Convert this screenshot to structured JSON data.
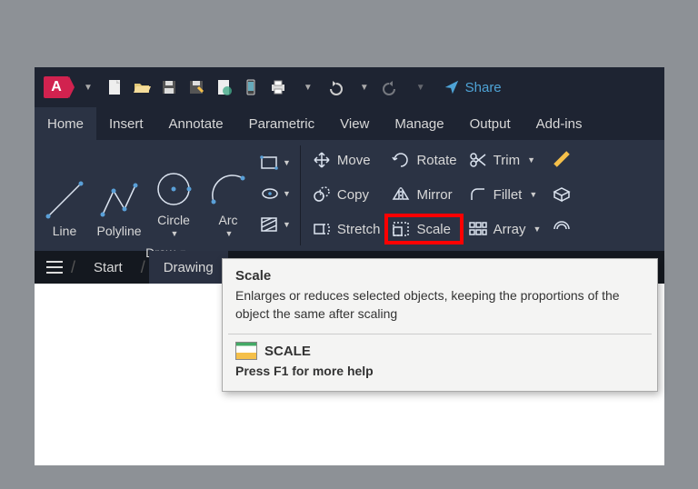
{
  "app": {
    "letter": "A"
  },
  "titlebar": {
    "share_label": "Share"
  },
  "menu": {
    "items": [
      {
        "label": "Home",
        "active": true
      },
      {
        "label": "Insert"
      },
      {
        "label": "Annotate"
      },
      {
        "label": "Parametric"
      },
      {
        "label": "View"
      },
      {
        "label": "Manage"
      },
      {
        "label": "Output"
      },
      {
        "label": "Add-ins"
      }
    ]
  },
  "ribbon": {
    "draw": {
      "line": "Line",
      "polyline": "Polyline",
      "circle": "Circle",
      "arc": "Arc",
      "panel_label": "Draw"
    },
    "modify": {
      "move": "Move",
      "copy": "Copy",
      "stretch": "Stretch",
      "rotate": "Rotate",
      "mirror": "Mirror",
      "scale": "Scale",
      "trim": "Trim",
      "fillet": "Fillet",
      "array": "Array"
    }
  },
  "tabs": {
    "start": "Start",
    "drawing": "Drawing"
  },
  "tooltip": {
    "title": "Scale",
    "description": "Enlarges or reduces selected objects, keeping the proportions of the object the same after scaling",
    "command": "SCALE",
    "help": "Press F1 for more help"
  }
}
